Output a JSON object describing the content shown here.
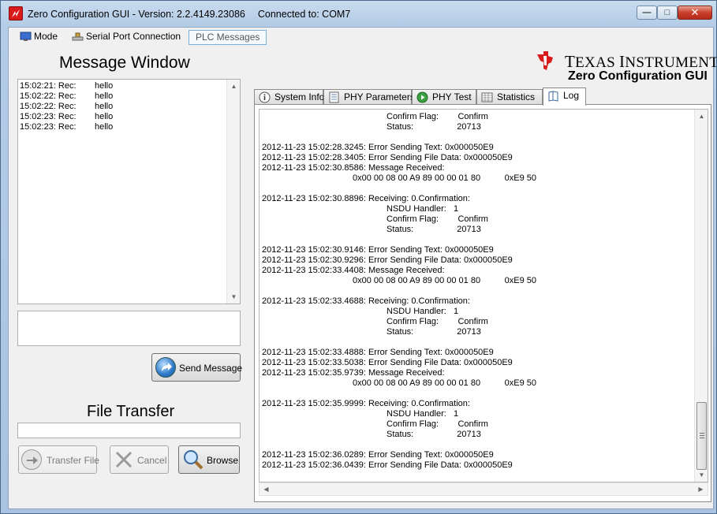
{
  "window": {
    "title": "Zero Configuration GUI - Version: 2.2.4149.23086",
    "connection": "Connected to: COM7"
  },
  "menu": {
    "mode": "Mode",
    "serial": "Serial Port Connection",
    "plc": "PLC Messages"
  },
  "message_window": {
    "heading": "Message Window",
    "messages": [
      {
        "time": "15:02:21: Rec:",
        "text": "hello"
      },
      {
        "time": "15:02:22: Rec:",
        "text": "hello"
      },
      {
        "time": "15:02:22: Rec:",
        "text": "hello"
      },
      {
        "time": "15:02:23: Rec:",
        "text": "hello"
      },
      {
        "time": "15:02:23: Rec:",
        "text": "hello"
      }
    ],
    "input_value": "",
    "send_label": "Send Message"
  },
  "file_transfer": {
    "heading": "File Transfer",
    "path_value": "",
    "transfer_label": "Transfer File",
    "cancel_label": "Cancel",
    "browse_label": "Browse"
  },
  "brand": {
    "company": "Texas Instruments",
    "company_display_t": "T",
    "company_display_1": "EXAS ",
    "company_display_i": "I",
    "company_display_2": "NSTRUMENTS",
    "product": "Zero Configuration GUI",
    "logo_color": "#d81a1a"
  },
  "tabs": [
    {
      "label": "System Info",
      "icon": "info-icon"
    },
    {
      "label": "PHY Parameters",
      "icon": "document-icon"
    },
    {
      "label": "PHY Test",
      "icon": "play-icon"
    },
    {
      "label": "Statistics",
      "icon": "spreadsheet-icon"
    },
    {
      "label": "Log",
      "icon": "book-icon",
      "active": true
    }
  ],
  "log": [
    "Confirm Flag:        Confirm",
    "Status:                  20713",
    "",
    "2012-11-23 15:02:28.3245: Error Sending Text: 0x000050E9",
    "2012-11-23 15:02:28.3405: Error Sending File Data: 0x000050E9",
    "2012-11-23 15:02:30.8586: Message Received:",
    "0x00 00 08 00 A9 89 00 00 01 80          0xE9 50",
    "",
    "2012-11-23 15:02:30.8896: Receiving: 0.Confirmation:",
    "NSDU Handler:   1",
    "Confirm Flag:        Confirm",
    "Status:                  20713",
    "",
    "2012-11-23 15:02:30.9146: Error Sending Text: 0x000050E9",
    "2012-11-23 15:02:30.9296: Error Sending File Data: 0x000050E9",
    "2012-11-23 15:02:33.4408: Message Received:",
    "0x00 00 08 00 A9 89 00 00 01 80          0xE9 50",
    "",
    "2012-11-23 15:02:33.4688: Receiving: 0.Confirmation:",
    "NSDU Handler:   1",
    "Confirm Flag:        Confirm",
    "Status:                  20713",
    "",
    "2012-11-23 15:02:33.4888: Error Sending Text: 0x000050E9",
    "2012-11-23 15:02:33.5038: Error Sending File Data: 0x000050E9",
    "2012-11-23 15:02:35.9739: Message Received:",
    "0x00 00 08 00 A9 89 00 00 01 80          0xE9 50",
    "",
    "2012-11-23 15:02:35.9999: Receiving: 0.Confirmation:",
    "NSDU Handler:   1",
    "Confirm Flag:        Confirm",
    "Status:                  20713",
    "",
    "2012-11-23 15:02:36.0289: Error Sending Text: 0x000050E9",
    "2012-11-23 15:02:36.0439: Error Sending File Data: 0x000050E9"
  ]
}
